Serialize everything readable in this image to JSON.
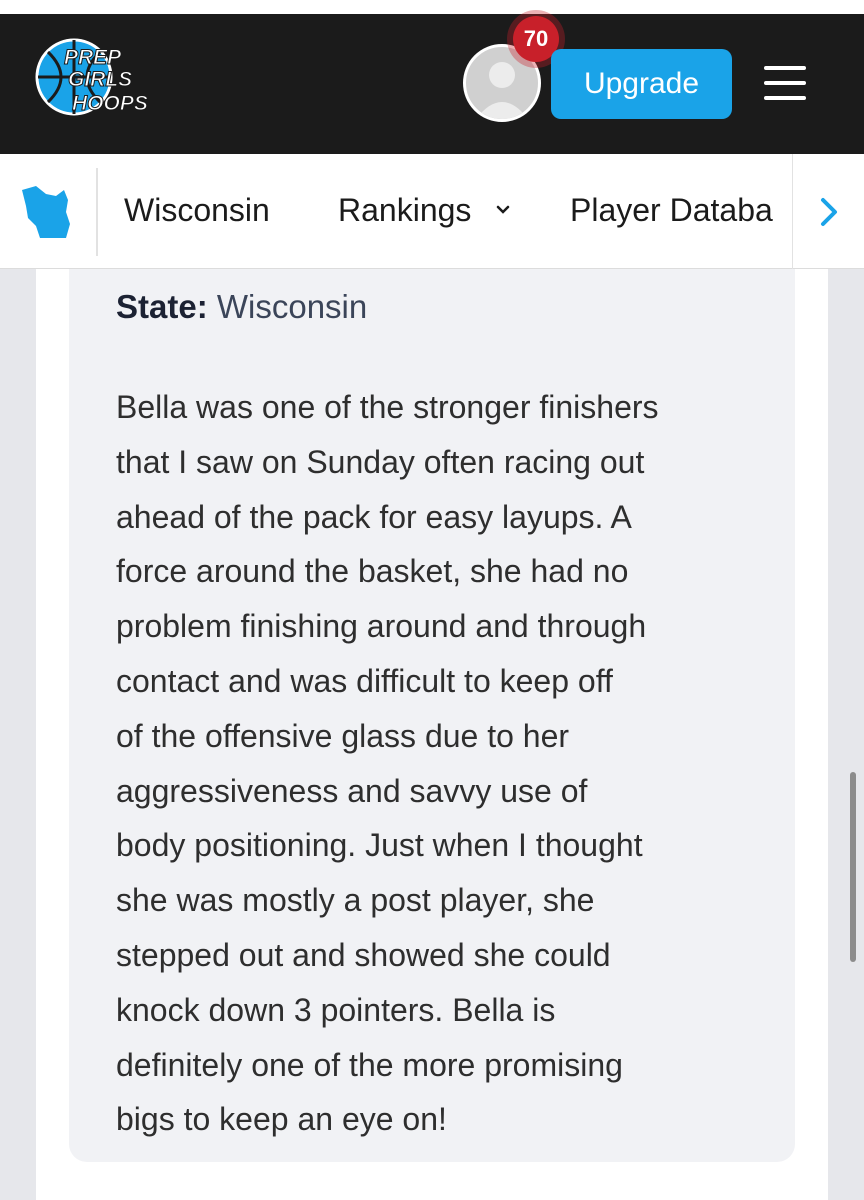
{
  "header": {
    "logo_text": [
      "PREP",
      "GIRLS",
      "HOOPS"
    ],
    "avatar": "avatar-icon",
    "notification_count": "70",
    "upgrade_label": "Upgrade",
    "menu_icon": "hamburger-menu-icon",
    "colors": {
      "bg": "#1b1b1b",
      "accent": "#1aa3e8",
      "badge": "#c8202a"
    }
  },
  "subnav": {
    "state_icon": "wisconsin-map-icon",
    "items": [
      {
        "label": "Wisconsin"
      },
      {
        "label": "Rankings",
        "icon": "chevron-down-icon"
      },
      {
        "label": "Player Databa"
      }
    ],
    "next_icon": "chevron-right-icon"
  },
  "profile": {
    "state_label": "State:",
    "state_value": "Wisconsin",
    "evaluation_lines": [
      "Bella was one of the stronger finishers",
      "that I saw on Sunday often racing out",
      "ahead of the pack for easy layups. A",
      "force around the basket, she had no",
      "problem finishing around and through",
      "contact and was difficult to keep off",
      "of the offensive glass due to her",
      "aggressiveness and savvy use of",
      "body positioning. Just when I thought",
      "she was mostly a post player, she",
      "stepped out and showed she could",
      "knock down 3 pointers. Bella is",
      "definitely one of the more promising",
      "bigs to keep an eye on!"
    ]
  }
}
